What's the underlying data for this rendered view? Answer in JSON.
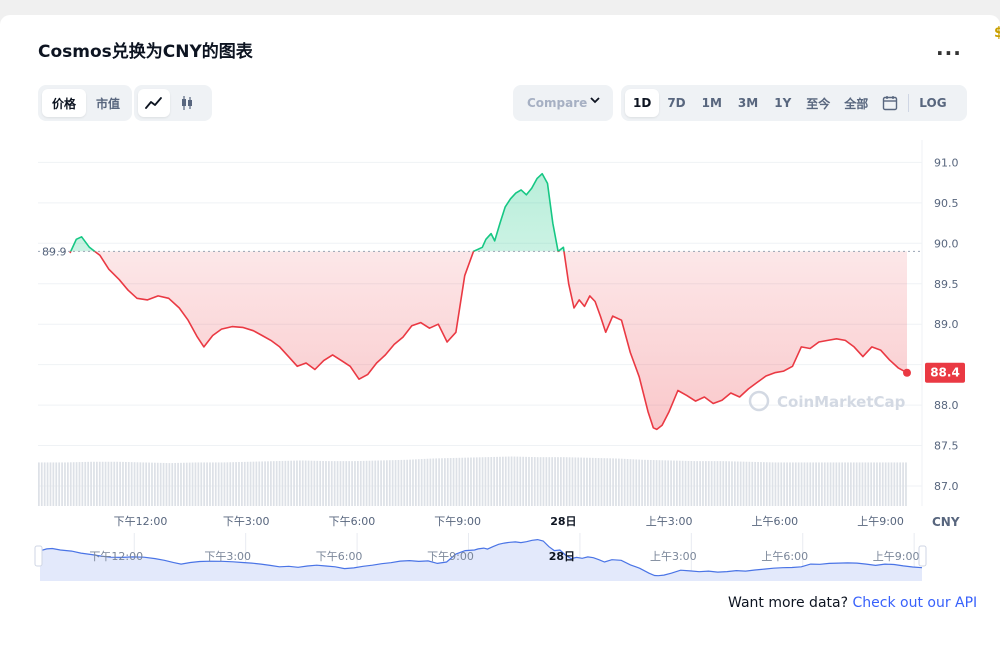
{
  "header": {
    "title": "Cosmos兑换为CNY的图表",
    "more_label": "..."
  },
  "toolbar": {
    "metric_tabs": [
      "价格",
      "市值"
    ],
    "compare_label": "Compare",
    "range_tabs": [
      "1D",
      "7D",
      "1M",
      "3M",
      "1Y",
      "至今",
      "全部"
    ],
    "log_label": "LOG"
  },
  "footer": {
    "text": "Want more data?",
    "link": "Check out our API"
  },
  "watermark": "CoinMarketCap",
  "colors": {
    "up": "#16c784",
    "down": "#ea3943",
    "accent": "#3861fb",
    "nav_line": "#4a74e6"
  },
  "chart_data": {
    "type": "line",
    "currency": "CNY",
    "baseline": 89.9,
    "current_price": 88.4,
    "ylim": [
      86.8,
      91.3
    ],
    "y_ticks": [
      91.0,
      90.5,
      90.0,
      89.5,
      89.0,
      88.5,
      88.0,
      87.5,
      87.0
    ],
    "y_tick_labels": [
      "91.0",
      "90.5",
      "90.0",
      "89.5",
      "89.0",
      "",
      "88.0",
      "87.5",
      "87.0"
    ],
    "baseline_label": "89.9",
    "current_label": "88.4",
    "x_axis_unit_label": "CNY",
    "x_ticks": [
      {
        "t": 2.0,
        "label": "下午12:00"
      },
      {
        "t": 5.0,
        "label": "下午3:00"
      },
      {
        "t": 8.0,
        "label": "下午6:00"
      },
      {
        "t": 11.0,
        "label": "下午9:00"
      },
      {
        "t": 14.0,
        "label": "28日"
      },
      {
        "t": 17.0,
        "label": "上午3:00"
      },
      {
        "t": 20.0,
        "label": "上午6:00"
      },
      {
        "t": 23.0,
        "label": "上午9:00"
      }
    ],
    "series": [
      {
        "t": [
          0,
          0.18,
          0.33,
          0.55,
          0.85,
          1.1,
          1.4,
          1.65,
          1.9,
          2.2,
          2.5,
          2.8,
          3.1,
          3.35,
          3.6,
          3.8,
          4.05,
          4.3,
          4.6,
          4.9,
          5.2,
          5.45,
          5.7,
          5.95,
          6.2,
          6.45,
          6.7,
          6.95,
          7.2,
          7.45,
          7.7,
          7.95,
          8.2,
          8.45,
          8.7,
          8.95,
          9.2,
          9.45,
          9.7,
          9.95,
          10.2,
          10.45,
          10.7,
          10.95,
          11.2,
          11.45,
          11.7,
          11.8,
          11.95,
          12.05,
          12.2,
          12.35,
          12.5,
          12.65,
          12.8,
          12.95,
          13.1,
          13.25,
          13.4,
          13.55,
          13.7,
          13.85,
          14.0,
          14.15,
          14.3,
          14.45,
          14.6,
          14.75,
          14.9,
          15.05,
          15.2,
          15.4,
          15.65,
          15.9,
          16.15,
          16.4,
          16.55,
          16.65,
          16.8,
          17.0,
          17.25,
          17.5,
          17.75,
          18.0,
          18.25,
          18.5,
          18.75,
          19.0,
          19.25,
          19.5,
          19.75,
          20.0,
          20.25,
          20.5,
          20.75,
          21.0,
          21.25,
          21.5,
          21.75,
          22.0,
          22.25,
          22.5,
          22.75,
          23.0,
          23.25,
          23.5,
          23.75
        ],
        "values": [
          89.88,
          90.05,
          90.08,
          89.95,
          89.85,
          89.68,
          89.55,
          89.42,
          89.32,
          89.3,
          89.35,
          89.32,
          89.2,
          89.05,
          88.85,
          88.72,
          88.86,
          88.94,
          88.97,
          88.96,
          88.92,
          88.86,
          88.8,
          88.72,
          88.6,
          88.48,
          88.52,
          88.44,
          88.55,
          88.62,
          88.55,
          88.48,
          88.32,
          88.38,
          88.52,
          88.62,
          88.75,
          88.84,
          88.98,
          89.02,
          88.95,
          89.0,
          88.78,
          88.9,
          89.6,
          89.9,
          89.95,
          90.05,
          90.12,
          90.03,
          90.25,
          90.45,
          90.55,
          90.62,
          90.66,
          90.6,
          90.68,
          90.8,
          90.86,
          90.74,
          90.25,
          89.9,
          89.95,
          89.5,
          89.2,
          89.3,
          89.22,
          89.35,
          89.28,
          89.1,
          88.9,
          89.1,
          89.05,
          88.65,
          88.35,
          87.92,
          87.72,
          87.7,
          87.75,
          87.92,
          88.18,
          88.12,
          88.05,
          88.1,
          88.02,
          88.06,
          88.15,
          88.1,
          88.2,
          88.28,
          88.36,
          88.4,
          88.42,
          88.48,
          88.72,
          88.7,
          88.78,
          88.8,
          88.82,
          88.8,
          88.72,
          88.6,
          88.72,
          88.68,
          88.56,
          88.46,
          88.4
        ]
      }
    ],
    "volume_relative": [
      0.66,
      0.66,
      0.67,
      0.67,
      0.66,
      0.65,
      0.66,
      0.66,
      0.67,
      0.68,
      0.69,
      0.68,
      0.68,
      0.69,
      0.7,
      0.72,
      0.73,
      0.74,
      0.75,
      0.74,
      0.74,
      0.73,
      0.72,
      0.7,
      0.69,
      0.68,
      0.68,
      0.67,
      0.66,
      0.66,
      0.66,
      0.66,
      0.66,
      0.66
    ],
    "navigator": {
      "x_labels": [
        "下午12:00",
        "下午3:00",
        "下午6:00",
        "下午9:00",
        "28日",
        "上午3:00",
        "上午6:00",
        "上午9:00"
      ]
    }
  }
}
